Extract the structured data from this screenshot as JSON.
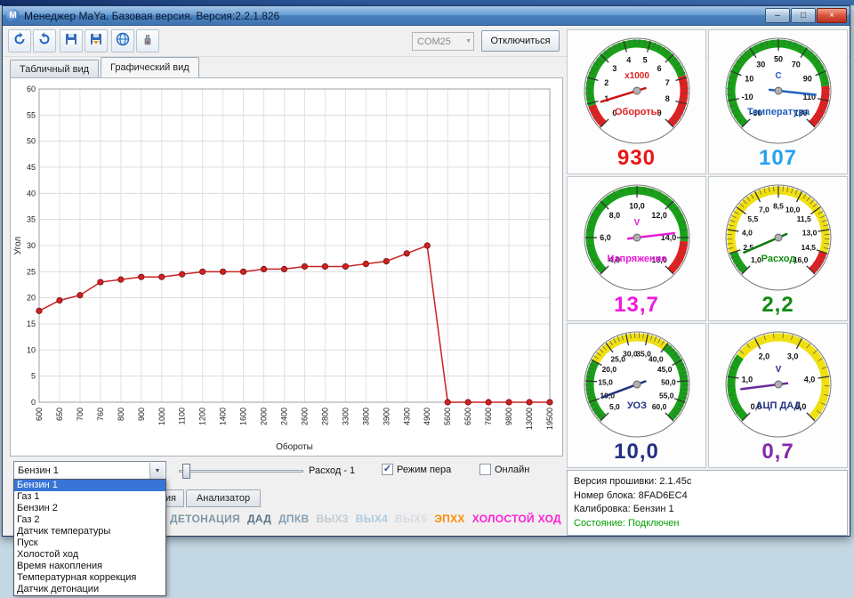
{
  "window": {
    "title": "Менеджер MaYa. Базовая версия. Версия:2.2.1.826",
    "min_glyph": "–",
    "max_glyph": "□",
    "close_glyph": "×"
  },
  "toolbar": {
    "com_port": "COM25",
    "disconnect": "Отключиться"
  },
  "view_tabs": {
    "table": "Табличный вид",
    "graphic": "Графический вид"
  },
  "chart_data": {
    "type": "line",
    "title": "",
    "xlabel": "Обороты",
    "ylabel": "Угол",
    "ylim": [
      0,
      60
    ],
    "ytick_step": 5,
    "categories": [
      600,
      650,
      700,
      760,
      800,
      900,
      1000,
      1100,
      1200,
      1400,
      1600,
      2000,
      2400,
      2600,
      2800,
      3300,
      3800,
      3900,
      4300,
      4900,
      5600,
      6500,
      7600,
      9800,
      13000,
      19500
    ],
    "values": [
      17.5,
      19.5,
      20.5,
      23,
      23.5,
      24,
      24,
      24.5,
      25,
      25,
      25,
      25.5,
      25.5,
      26,
      26,
      26,
      26.5,
      27,
      28.5,
      30,
      0,
      0,
      0,
      0,
      0,
      0
    ],
    "line_color": "#cc2222",
    "marker_color": "#cc2222",
    "grid": true,
    "legend": false
  },
  "controls": {
    "combo_value": "Бензин 1",
    "slider_label": "Расход - 1",
    "pen_label": "Режим пера",
    "pen_check": "✓",
    "online_label": "Онлайн",
    "online_check": ""
  },
  "dropdown": {
    "selected_index": 0,
    "items": [
      "Бензин 1",
      "Газ 1",
      "Бензин 2",
      "Газ 2",
      "Датчик температуры",
      "Пуск",
      "Холостой ход",
      "Время накопления",
      "Температурная коррекция",
      "Датчик детонации"
    ]
  },
  "bottom_tabs": {
    "partial": "ия",
    "analyzer": "Анализатор"
  },
  "status_indicators": [
    {
      "label": "ДЕТОНАЦИЯ",
      "color": "#7d97a5"
    },
    {
      "label": "ДАД",
      "color": "#5a7585"
    },
    {
      "label": "ДПКВ",
      "color": "#86a0b5"
    },
    {
      "label": "ВЫХ3",
      "color": "#c2cbd2"
    },
    {
      "label": "ВЫХ4",
      "color": "#aacbe2"
    },
    {
      "label": "ВЫХ5",
      "color": "#d5dbe0"
    },
    {
      "label": "ЭПХХ",
      "color": "#ff8a00"
    },
    {
      "label": "ХОЛОСТОЙ ХОД",
      "color": "#ff1fd4"
    }
  ],
  "gauges": [
    {
      "id": "rpm",
      "name": "Обороты",
      "unit": "x1000",
      "value_display": "930",
      "min": 0,
      "max": 9,
      "tick_labels": [
        "0",
        "1",
        "2",
        "3",
        "4",
        "5",
        "6",
        "7",
        "8",
        "9"
      ],
      "needle_value": 0.93,
      "color": "#e02020",
      "value_color": "#e81616",
      "needle_color": "#cc1414",
      "label_size": 9,
      "segments": [
        {
          "from": 0,
          "to": 0.9,
          "color": "#e02020"
        },
        {
          "from": 0.9,
          "to": 6.9,
          "color": "#18a018"
        },
        {
          "from": 6.9,
          "to": 9,
          "color": "#e02020"
        }
      ]
    },
    {
      "id": "temperature",
      "name": "Температура",
      "unit": "C",
      "value_display": "107",
      "min": -30,
      "max": 130,
      "tick_labels": [
        "-30",
        "-10",
        "10",
        "30",
        "50",
        "70",
        "90",
        "110",
        "130"
      ],
      "needle_value": 107,
      "color": "#2060c0",
      "value_color": "#28a0f0",
      "needle_color": "#2060c0",
      "label_size": 9,
      "segments": [
        {
          "from": -30,
          "to": 100,
          "color": "#18a018"
        },
        {
          "from": 100,
          "to": 130,
          "color": "#e02020"
        }
      ]
    },
    {
      "id": "voltage",
      "name": "Напряжение",
      "unit": "V",
      "value_display": "13,7",
      "min": 4,
      "max": 16,
      "tick_labels": [
        "4,0",
        "6,0",
        "8,0",
        "10,0",
        "12,0",
        "14,0",
        "16,0"
      ],
      "needle_value": 13.7,
      "color": "#e818d8",
      "value_color": "#f018e0",
      "needle_color": "#e818d8",
      "label_size": 9,
      "segments": [
        {
          "from": 4,
          "to": 14.2,
          "color": "#18a018"
        },
        {
          "from": 14.2,
          "to": 16,
          "color": "#e02020"
        }
      ]
    },
    {
      "id": "flow",
      "name": "Расход",
      "unit": "",
      "value_display": "2,2",
      "min": 1,
      "max": 16,
      "tick_labels": [
        "1,0",
        "2,5",
        "4,0",
        "5,5",
        "7,0",
        "8,5",
        "10,0",
        "11,5",
        "13,0",
        "14,5",
        "16,0"
      ],
      "needle_value": 2.2,
      "color": "#108a10",
      "value_color": "#108a10",
      "needle_color": "#0c7a0c",
      "label_size": 8.5,
      "segments": [
        {
          "from": 1,
          "to": 2.5,
          "color": "#18a018"
        },
        {
          "from": 2.5,
          "to": 14.5,
          "color": "#f0e010"
        },
        {
          "from": 14.5,
          "to": 16,
          "color": "#e02020"
        }
      ]
    },
    {
      "id": "uoz",
      "name": "УОЗ",
      "unit": "",
      "value_display": "10,0",
      "min": 5,
      "max": 60,
      "tick_labels": [
        "5,0",
        "10,0",
        "15,0",
        "20,0",
        "25,0",
        "30,0",
        "35,0",
        "40,0",
        "45,0",
        "50,0",
        "55,0",
        "60,0"
      ],
      "needle_value": 10,
      "color": "#203080",
      "value_color": "#203080",
      "needle_color": "#203080",
      "label_size": 8.5,
      "segments": [
        {
          "from": 5,
          "to": 20,
          "color": "#18a018"
        },
        {
          "from": 20,
          "to": 40,
          "color": "#f0e010"
        },
        {
          "from": 40,
          "to": 60,
          "color": "#18a018"
        }
      ]
    },
    {
      "id": "adc_dad",
      "name": "АЦП ДАД",
      "unit": "V",
      "value_display": "0,7",
      "min": 0,
      "max": 5,
      "tick_labels": [
        "0,0",
        "1,0",
        "2,0",
        "3,0",
        "4,0",
        "5,0"
      ],
      "needle_value": 0.7,
      "color": "#203080",
      "value_color": "#8428a8",
      "needle_color": "#6a2a9a",
      "label_size": 9,
      "segments": [
        {
          "from": 0,
          "to": 1.5,
          "color": "#18a018"
        },
        {
          "from": 1.5,
          "to": 5,
          "color": "#f0e010"
        }
      ]
    }
  ],
  "info": {
    "firmware": "Версия прошивки:  2.1.45c",
    "block": "Номер блока: 8FAD6EC4",
    "calibration": "Калибровка: Бензин 1",
    "state": "Состояние: Подключен",
    "state_color": "#00a000"
  }
}
